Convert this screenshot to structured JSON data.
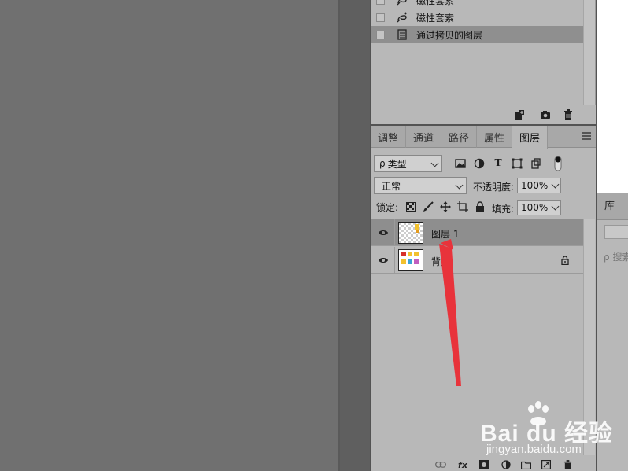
{
  "history": {
    "items": [
      {
        "label": "磁性套索",
        "selected": false,
        "partial": true
      },
      {
        "label": "磁性套索",
        "selected": false
      },
      {
        "label": "通过拷贝的图层",
        "selected": true
      }
    ]
  },
  "tabs": [
    {
      "label": "调整",
      "active": false
    },
    {
      "label": "通道",
      "active": false
    },
    {
      "label": "路径",
      "active": false
    },
    {
      "label": "属性",
      "active": false
    },
    {
      "label": "图层",
      "active": true
    }
  ],
  "filter": {
    "kind_value": "类型",
    "search_glyph": "ρ"
  },
  "blend": {
    "mode": "正常",
    "opacity_label": "不透明度:",
    "opacity_value": "100%"
  },
  "lock": {
    "label": "锁定:",
    "fill_label": "填充:",
    "fill_value": "100%"
  },
  "layers": [
    {
      "name": "图层 1",
      "visible": true,
      "selected": true,
      "locked": false
    },
    {
      "name": "背景",
      "visible": true,
      "selected": false,
      "locked": true
    }
  ],
  "layers_bottom": {
    "fx_label": "fx"
  },
  "library": {
    "tab_label": "库",
    "search_placeholder": "搜索"
  },
  "watermark": {
    "brand": "Bai du 经验",
    "url": "jingyan.baidu.com"
  },
  "colors": {
    "panel_bg": "#b8b8b8",
    "canvas_bg": "#707070",
    "selected_row": "#8e8e8e",
    "arrow": "#e8333b"
  }
}
